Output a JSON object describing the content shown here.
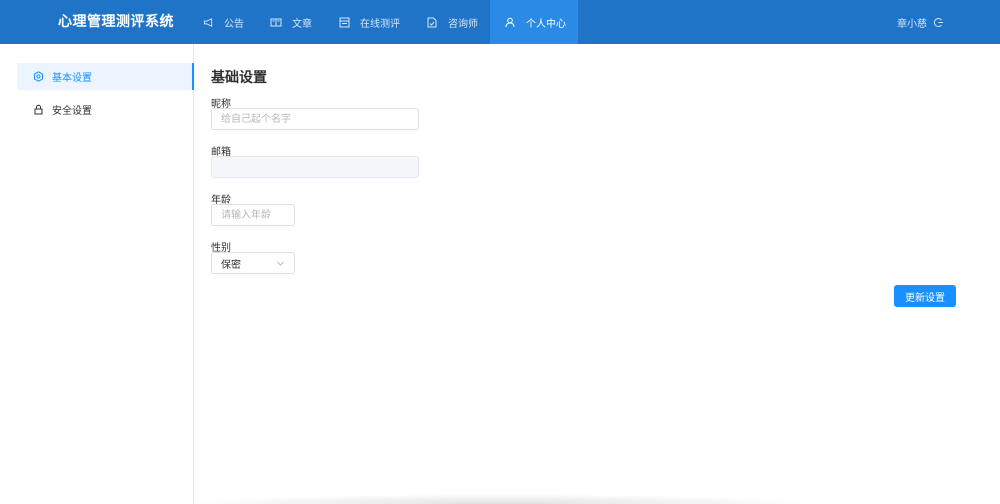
{
  "header": {
    "brand": "心理管理测评系统",
    "nav": [
      {
        "label": "公告",
        "icon": "megaphone-icon"
      },
      {
        "label": "文章",
        "icon": "book-icon"
      },
      {
        "label": "在线测评",
        "icon": "form-icon"
      },
      {
        "label": "咨询师",
        "icon": "document-icon"
      },
      {
        "label": "个人中心",
        "icon": "user-icon",
        "active": true
      }
    ],
    "user_name": "章小慈",
    "logout_icon": "logout-icon"
  },
  "sidebar": {
    "items": [
      {
        "label": "基本设置",
        "icon": "settings-icon",
        "active": true
      },
      {
        "label": "安全设置",
        "icon": "lock-icon"
      }
    ]
  },
  "form": {
    "title": "基础设置",
    "nickname": {
      "label": "昵称",
      "placeholder": "给自己起个名字",
      "value": ""
    },
    "email": {
      "label": "邮箱",
      "value": ""
    },
    "age": {
      "label": "年龄",
      "placeholder": "请输入年龄",
      "value": ""
    },
    "gender": {
      "label": "性别",
      "value": "保密"
    },
    "submit_label": "更新设置"
  },
  "colors": {
    "header_bg": "#1f74c7",
    "active_nav": "#2b8ae6",
    "primary": "#1890ff"
  }
}
